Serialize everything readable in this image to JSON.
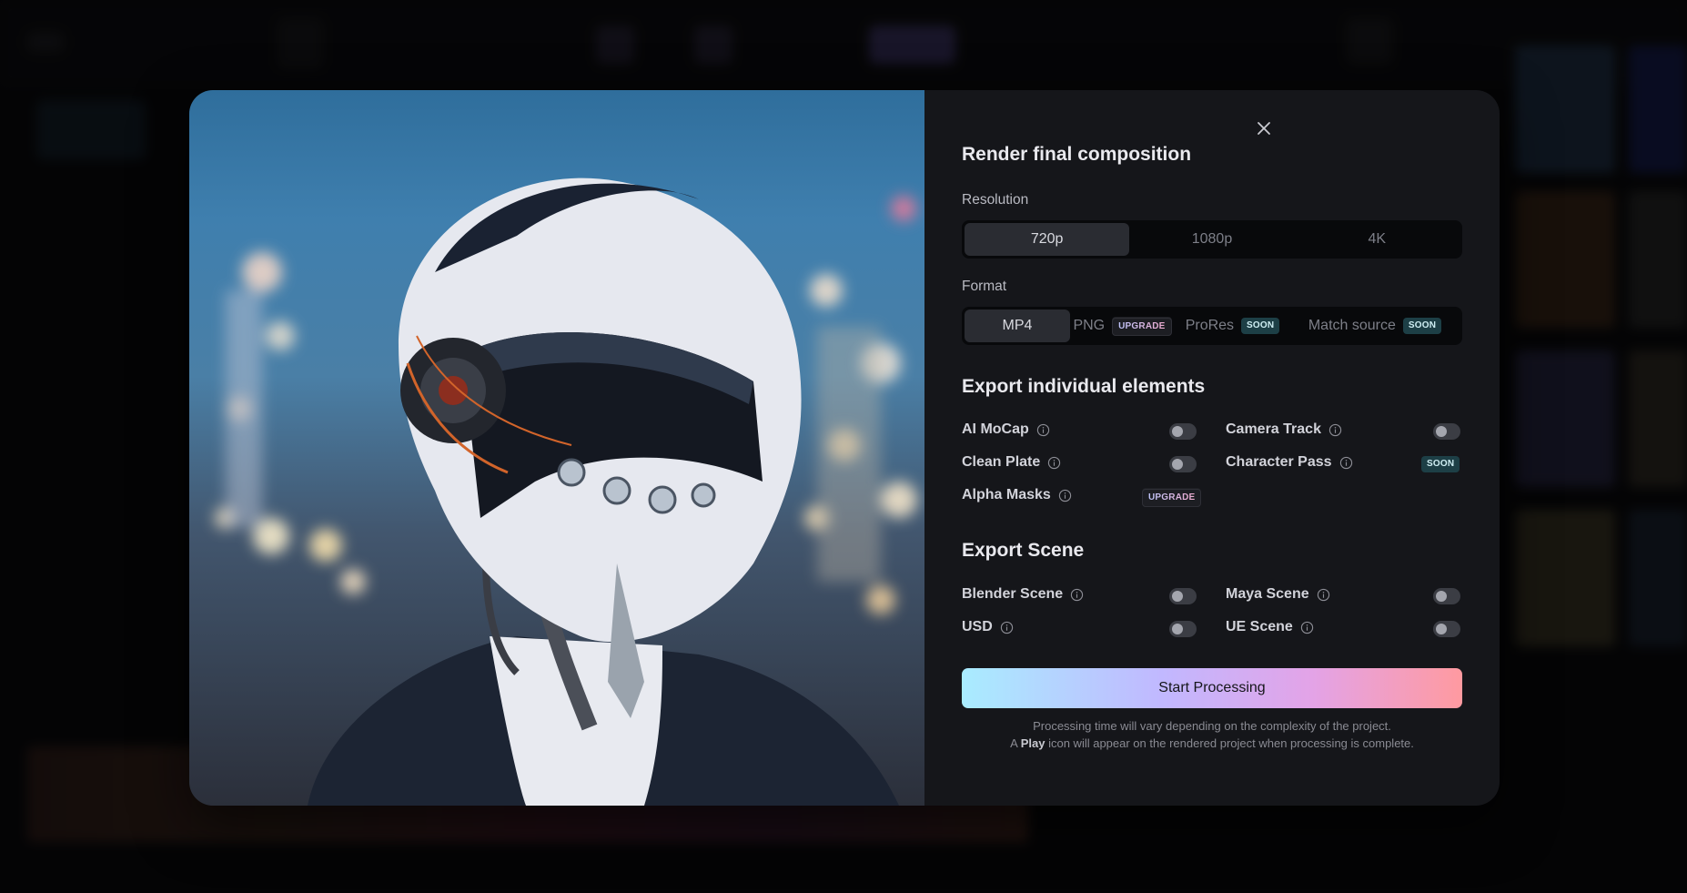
{
  "modal": {
    "title": "Render final composition",
    "resolution": {
      "label": "Resolution",
      "options": [
        "720p",
        "1080p",
        "4K"
      ],
      "selected": "720p"
    },
    "format": {
      "label": "Format",
      "options": [
        {
          "label": "MP4",
          "badge": ""
        },
        {
          "label": "PNG",
          "badge": "UPGRADE"
        },
        {
          "label": "ProRes",
          "badge": "SOON"
        },
        {
          "label": "Match source",
          "badge": "SOON"
        }
      ],
      "selected": "MP4"
    },
    "export_elements": {
      "title": "Export individual elements",
      "items": [
        {
          "label": "AI MoCap",
          "state": "toggle-off"
        },
        {
          "label": "Camera Track",
          "state": "toggle-off"
        },
        {
          "label": "Clean Plate",
          "state": "toggle-off"
        },
        {
          "label": "Character Pass",
          "state": "SOON"
        },
        {
          "label": "Alpha Masks",
          "state": "UPGRADE"
        }
      ]
    },
    "export_scene": {
      "title": "Export Scene",
      "items": [
        {
          "label": "Blender Scene",
          "state": "toggle-off"
        },
        {
          "label": "Maya Scene",
          "state": "toggle-off"
        },
        {
          "label": "USD",
          "state": "toggle-off"
        },
        {
          "label": "UE Scene",
          "state": "toggle-off"
        }
      ]
    },
    "start_button": "Start Processing",
    "note_line1": "Processing time will vary depending on the complexity of the project.",
    "note_line2_prefix": "A",
    "note_line2_bold": "Play",
    "note_line2_suffix": "icon will appear on the rendered project when processing is complete."
  },
  "icons": {
    "close": "close-icon",
    "info": "info-icon"
  },
  "colors": {
    "modal_bg": "#15161a",
    "soon_badge_bg": "#1d3f46",
    "button_gradient": [
      "#a9ecff",
      "#c1b8ff",
      "#e3a3e7",
      "#ff9aa0"
    ]
  }
}
